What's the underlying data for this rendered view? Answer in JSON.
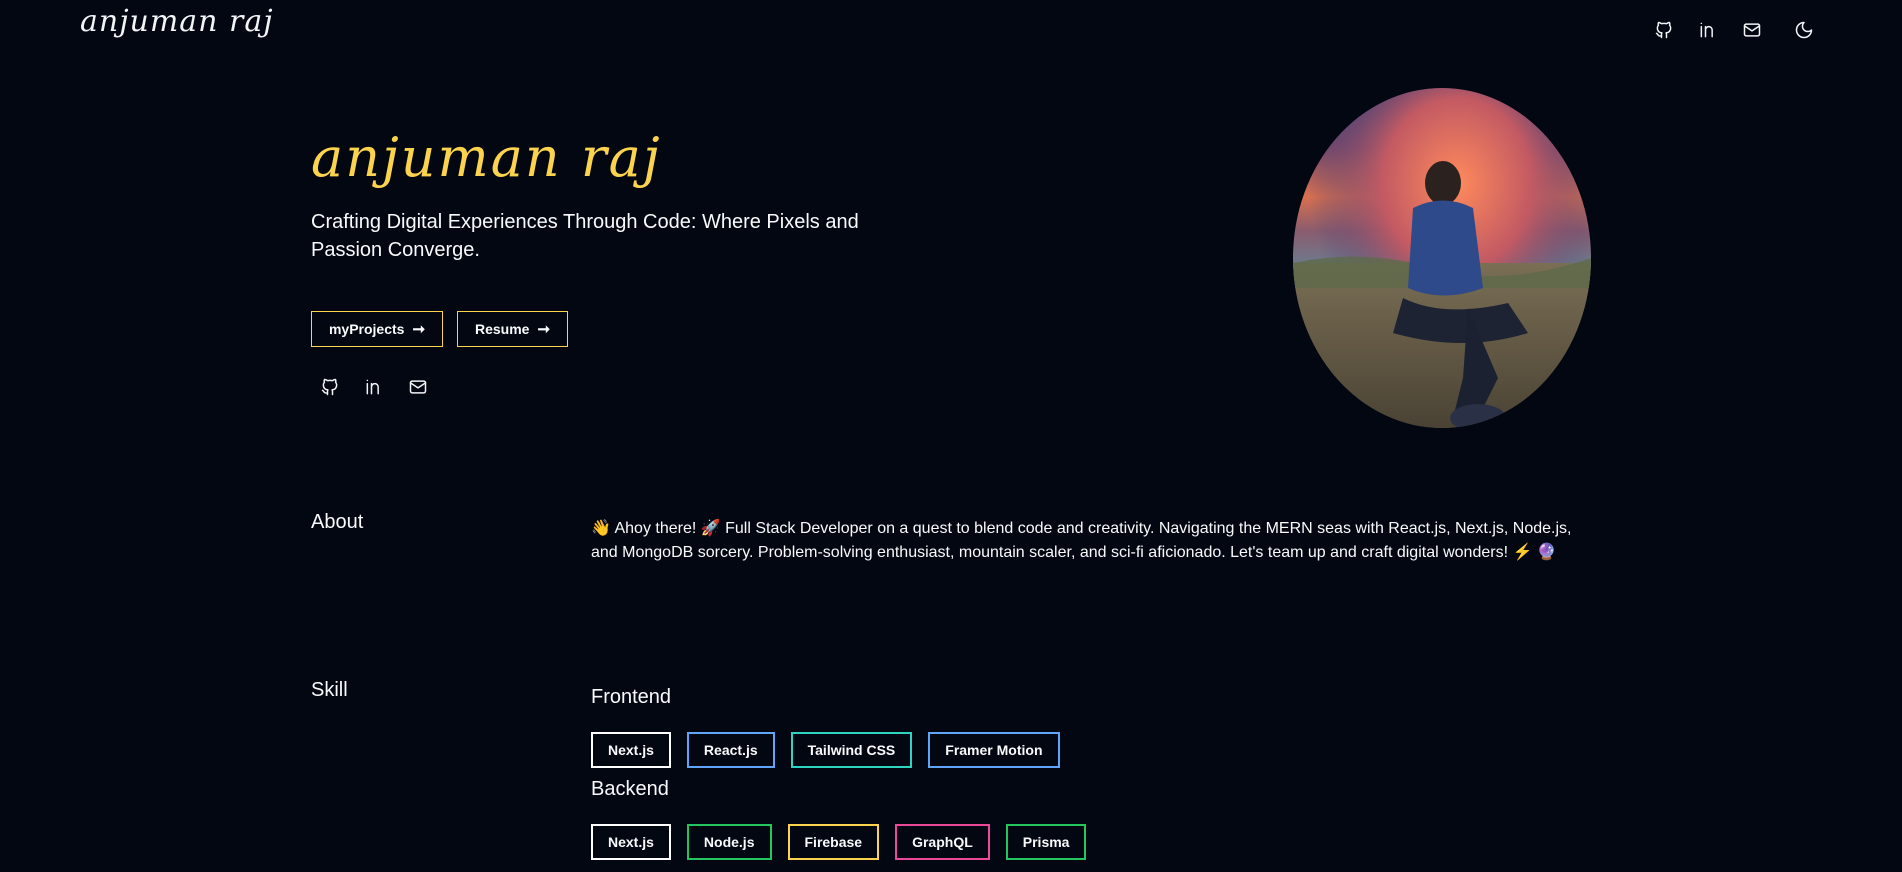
{
  "nav": {
    "logo": "anjuman raj",
    "icons": [
      "github-icon",
      "linkedin-icon",
      "mail-icon",
      "moon-icon"
    ]
  },
  "hero": {
    "name": "anjuman raj",
    "tagline": "Crafting Digital Experiences Through Code: Where Pixels and Passion Converge.",
    "buttons": [
      {
        "label": "myProjects",
        "arrow": "➞"
      },
      {
        "label": "Resume",
        "arrow": "➞"
      }
    ],
    "socials": [
      "github-icon",
      "linkedin-icon",
      "mail-icon"
    ]
  },
  "about": {
    "label": "About",
    "text": "👋 Ahoy there! 🚀 Full Stack Developer on a quest to blend code and creativity. Navigating the MERN seas with React.js, Next.js, Node.js, and MongoDB sorcery. Problem-solving enthusiast, mountain scaler, and sci-fi aficionado. Let's team up and craft digital wonders! ⚡ 🔮"
  },
  "skill": {
    "label": "Skill",
    "groups": [
      {
        "title": "Frontend",
        "items": [
          {
            "name": "Next.js",
            "color": "#ffffff"
          },
          {
            "name": "React.js",
            "color": "#60a5fa"
          },
          {
            "name": "Tailwind CSS",
            "color": "#2dd4bf"
          },
          {
            "name": "Framer Motion",
            "color": "#60a5fa"
          }
        ]
      },
      {
        "title": "Backend",
        "items": [
          {
            "name": "Next.js",
            "color": "#ffffff"
          },
          {
            "name": "Node.js",
            "color": "#22c55e"
          },
          {
            "name": "Firebase",
            "color": "#fcd34d"
          },
          {
            "name": "GraphQL",
            "color": "#ec4899"
          },
          {
            "name": "Prisma",
            "color": "#22c55e"
          }
        ]
      }
    ]
  },
  "colors": {
    "background": "#030712",
    "accent": "#fcd34d",
    "text": "#f9fafb"
  }
}
